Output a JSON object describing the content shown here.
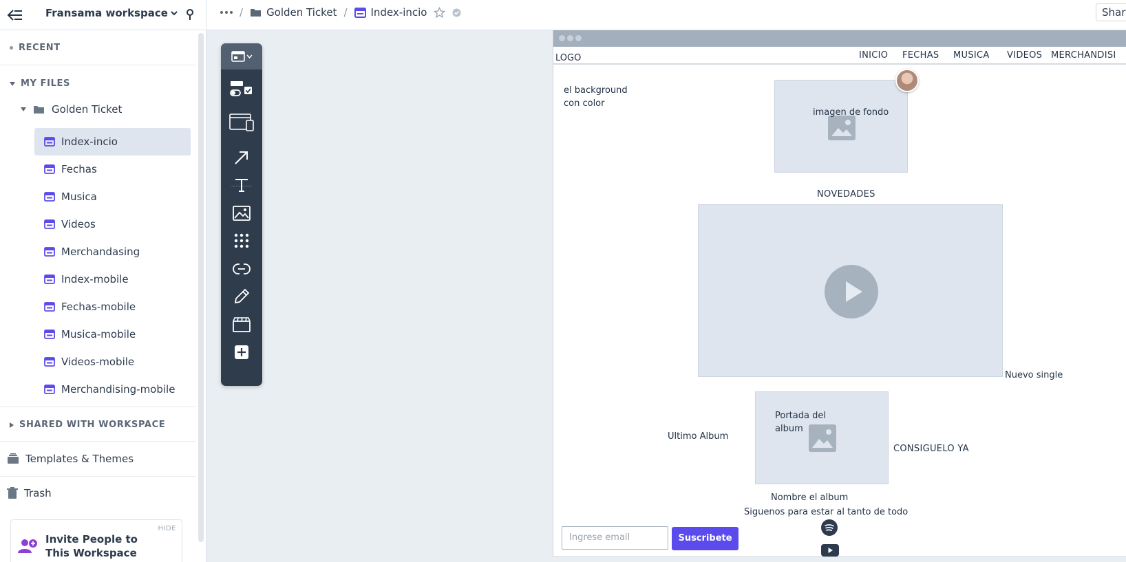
{
  "topbar": {
    "workspace_name": "Fransama workspace",
    "breadcrumb": {
      "project": "Golden Ticket",
      "page": "Index-incio"
    },
    "share_label": "Shar"
  },
  "sidebar": {
    "recent_label": "RECENT",
    "my_files_label": "MY FILES",
    "folder_name": "Golden Ticket",
    "files": [
      {
        "label": "Index-incio",
        "active": true
      },
      {
        "label": "Fechas"
      },
      {
        "label": "Musica"
      },
      {
        "label": "Videos"
      },
      {
        "label": "Merchandasing"
      },
      {
        "label": "Index-mobile"
      },
      {
        "label": "Fechas-mobile"
      },
      {
        "label": "Musica-mobile"
      },
      {
        "label": "Videos-mobile"
      },
      {
        "label": "Merchandising-mobile"
      }
    ],
    "shared_label": "SHARED WITH WORKSPACE",
    "templates_label": "Templates & Themes",
    "trash_label": "Trash",
    "invite": {
      "hide_label": "HIDE",
      "text": "Invite People to This Workspace"
    }
  },
  "wireframe": {
    "logo": "LOGO",
    "nav": [
      "INICIO",
      "FECHAS",
      "MUSICA",
      "VIDEOS",
      "MERCHANDISI"
    ],
    "bg_note": "el background con color",
    "hero_caption": "imagen de fondo",
    "section_title": "NOVEDADES",
    "video_caption": "Nuevo single",
    "album_left": "Ultimo Album",
    "album_caption": "Portada del album",
    "album_right": "CONSIGUELO YA",
    "album_name": "Nombre el album",
    "follow_text": "Siguenos para estar al tanto de todo",
    "email_placeholder": "Ingrese email",
    "subscribe_label": "Suscribete"
  },
  "colors": {
    "accent": "#5b4bec",
    "file_icon": "#5b4bec",
    "palette_bg": "#2f3c4c",
    "placeholder_bg": "#dfe5ee"
  }
}
